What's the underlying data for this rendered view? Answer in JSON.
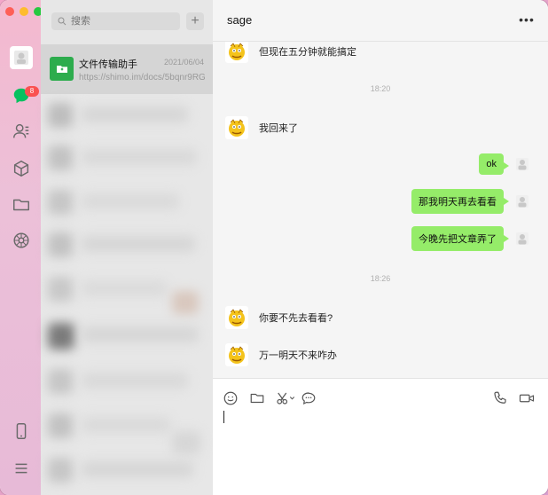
{
  "app": {
    "badge_count": "8"
  },
  "sidebar": {
    "search_placeholder": "搜索",
    "add_label": "+",
    "active_chat": {
      "name": "文件传输助手",
      "date": "2021/06/04",
      "preview": "https://shimo.im/docs/5bqnr9RG..."
    }
  },
  "chat": {
    "title": "sage",
    "more_label": "•••",
    "messages": [
      {
        "side": "left",
        "text": "但现在五分钟就能搞定"
      },
      {
        "type": "time",
        "text": "18:20"
      },
      {
        "side": "left",
        "text": "我回来了"
      },
      {
        "side": "right",
        "text": "ok"
      },
      {
        "side": "right",
        "text": "那我明天再去看看"
      },
      {
        "side": "right",
        "text": "今晚先把文章弄了"
      },
      {
        "type": "time",
        "text": "18:26"
      },
      {
        "side": "left",
        "text": "你要不先去看看?"
      },
      {
        "side": "left",
        "text": "万一明天不来咋办"
      }
    ]
  },
  "colors": {
    "accent_green": "#95ec69",
    "badge_red": "#fa5151",
    "file_tile_green": "#2dac4d"
  },
  "icons": {
    "rail": [
      "avatar",
      "chat-icon",
      "contacts-icon",
      "cube-icon",
      "folder-icon",
      "moments-icon",
      "phone-icon",
      "menu-icon"
    ],
    "composer": [
      "emoji-icon",
      "folder-icon",
      "scissors-icon",
      "chat-bubble-icon",
      "phone-icon",
      "video-icon"
    ]
  }
}
